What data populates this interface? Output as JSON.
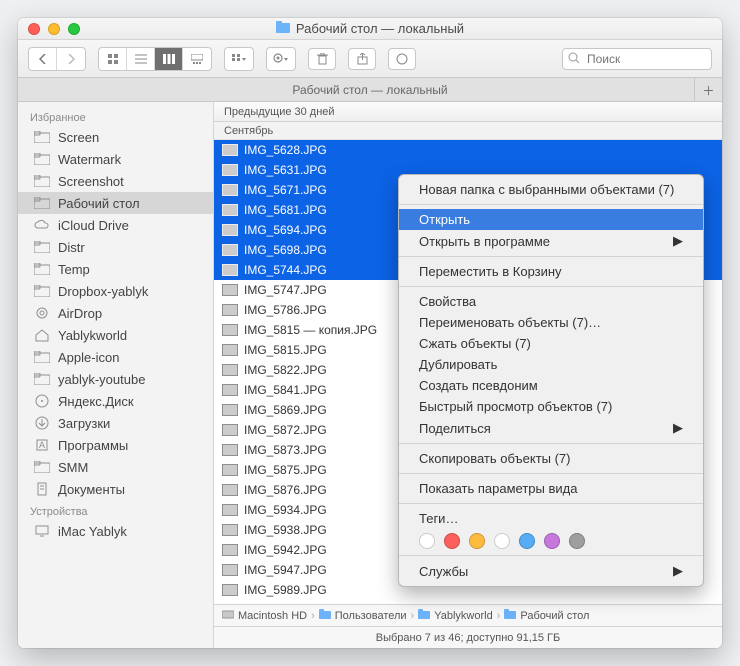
{
  "window": {
    "title": "Рабочий стол — локальный",
    "traffic": {
      "close": "#ff5f57",
      "min": "#ffbd2e",
      "max": "#28c940"
    }
  },
  "toolbar": {
    "search_placeholder": "Поиск"
  },
  "tabbar": {
    "label": "Рабочий стол — локальный"
  },
  "sidebar": {
    "heading_fav": "Избранное",
    "heading_dev": "Устройства",
    "items": [
      {
        "label": "Screen",
        "icon": "folder"
      },
      {
        "label": "Watermark",
        "icon": "folder"
      },
      {
        "label": "Screenshot",
        "icon": "folder"
      },
      {
        "label": "Рабочий стол",
        "icon": "folder",
        "selected": true
      },
      {
        "label": "iCloud Drive",
        "icon": "cloud"
      },
      {
        "label": "Distr",
        "icon": "folder"
      },
      {
        "label": "Temp",
        "icon": "folder"
      },
      {
        "label": "Dropbox-yablyk",
        "icon": "folder"
      },
      {
        "label": "AirDrop",
        "icon": "airdrop"
      },
      {
        "label": "Yablykworld",
        "icon": "home"
      },
      {
        "label": "Apple-icon",
        "icon": "folder"
      },
      {
        "label": "yablyk-youtube",
        "icon": "folder"
      },
      {
        "label": "Яндекс.Диск",
        "icon": "disk"
      },
      {
        "label": "Загрузки",
        "icon": "download"
      },
      {
        "label": "Программы",
        "icon": "apps"
      },
      {
        "label": "SMM",
        "icon": "folder"
      },
      {
        "label": "Документы",
        "icon": "docs"
      }
    ],
    "devices": [
      {
        "label": "iMac Yablyk",
        "icon": "imac"
      }
    ]
  },
  "list": {
    "header": "Предыдущие 30 дней",
    "group": "Сентябрь",
    "files": [
      {
        "name": "IMG_5628.JPG",
        "sel": true
      },
      {
        "name": "IMG_5631.JPG",
        "sel": true
      },
      {
        "name": "IMG_5671.JPG",
        "sel": true
      },
      {
        "name": "IMG_5681.JPG",
        "sel": true
      },
      {
        "name": "IMG_5694.JPG",
        "sel": true
      },
      {
        "name": "IMG_5698.JPG",
        "sel": true
      },
      {
        "name": "IMG_5744.JPG",
        "sel": true
      },
      {
        "name": "IMG_5747.JPG",
        "sel": false
      },
      {
        "name": "IMG_5786.JPG",
        "sel": false
      },
      {
        "name": "IMG_5815 — копия.JPG",
        "sel": false
      },
      {
        "name": "IMG_5815.JPG",
        "sel": false
      },
      {
        "name": "IMG_5822.JPG",
        "sel": false
      },
      {
        "name": "IMG_5841.JPG",
        "sel": false
      },
      {
        "name": "IMG_5869.JPG",
        "sel": false
      },
      {
        "name": "IMG_5872.JPG",
        "sel": false
      },
      {
        "name": "IMG_5873.JPG",
        "sel": false
      },
      {
        "name": "IMG_5875.JPG",
        "sel": false
      },
      {
        "name": "IMG_5876.JPG",
        "sel": false
      },
      {
        "name": "IMG_5934.JPG",
        "sel": false
      },
      {
        "name": "IMG_5938.JPG",
        "sel": false
      },
      {
        "name": "IMG_5942.JPG",
        "sel": false
      },
      {
        "name": "IMG_5947.JPG",
        "sel": false
      },
      {
        "name": "IMG_5989.JPG",
        "sel": false
      }
    ]
  },
  "context_menu": {
    "items": [
      {
        "label": "Новая папка с выбранными объектами (7)"
      },
      {
        "sep": true
      },
      {
        "label": "Открыть",
        "hl": true
      },
      {
        "label": "Открыть в программе",
        "sub": true
      },
      {
        "sep": true
      },
      {
        "label": "Переместить в Корзину"
      },
      {
        "sep": true
      },
      {
        "label": "Свойства"
      },
      {
        "label": "Переименовать объекты (7)…"
      },
      {
        "label": "Сжать объекты (7)"
      },
      {
        "label": "Дублировать"
      },
      {
        "label": "Создать псевдоним"
      },
      {
        "label": "Быстрый просмотр объектов (7)"
      },
      {
        "label": "Поделиться",
        "sub": true
      },
      {
        "sep": true
      },
      {
        "label": "Скопировать объекты (7)"
      },
      {
        "sep": true
      },
      {
        "label": "Показать параметры вида"
      },
      {
        "sep": true
      },
      {
        "label": "Теги…",
        "tags_header": true
      },
      {
        "tags": [
          "",
          "#fc605c",
          "#fdbc40",
          "",
          "#57acf5",
          "#c678dd",
          "#9e9e9e"
        ]
      },
      {
        "sep": true
      },
      {
        "label": "Службы",
        "sub": true
      }
    ]
  },
  "pathbar": {
    "items": [
      "Macintosh HD",
      "Пользователи",
      "Yablykworld",
      "Рабочий стол"
    ]
  },
  "statusbar": {
    "text": "Выбрано 7 из 46; доступно 91,15 ГБ"
  }
}
